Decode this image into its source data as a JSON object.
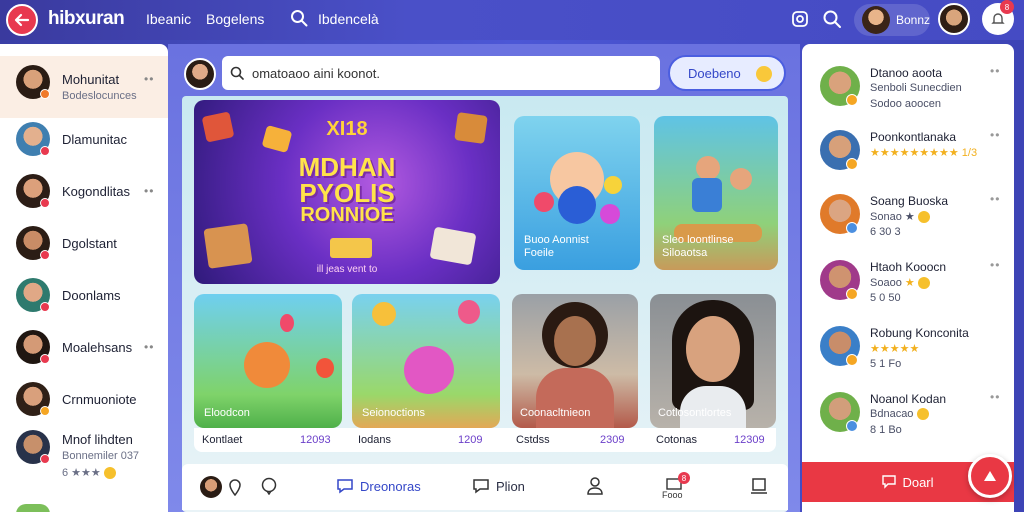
{
  "colors": {
    "accent": "#4b5ee0",
    "danger": "#e93844",
    "topbar": "#3a3a9e"
  },
  "topbar": {
    "brand": "hibxuran",
    "nav": [
      "Ibeanic",
      "Bogelens"
    ],
    "search_text": "Ibdencelà",
    "user_chip_name": "Bonnz",
    "notification_count": "8",
    "icons": [
      "back-arrow-icon",
      "search-icon",
      "settings-icon",
      "bell-icon"
    ]
  },
  "sidebar_left": {
    "items": [
      {
        "name": "Mohunitat",
        "sub": "Bodeslocunces",
        "badge_color": "#f07a2a",
        "active": true,
        "more": "••"
      },
      {
        "name": "Dlamunitac",
        "sub": "",
        "badge_color": "#e8394f",
        "active": false,
        "more": ""
      },
      {
        "name": "Kogondlitas",
        "sub": "",
        "badge_color": "#e8394f",
        "active": false,
        "more": "••"
      },
      {
        "name": "Dgolstant",
        "sub": "",
        "badge_color": "#e8394f",
        "active": false,
        "more": ""
      },
      {
        "name": "Doonlams",
        "sub": "",
        "badge_color": "#e8394f",
        "active": false,
        "more": ""
      },
      {
        "name": "Moalehsans",
        "sub": "",
        "badge_color": "#e8394f",
        "active": false,
        "more": "••"
      },
      {
        "name": "Crnmuoniote",
        "sub": "",
        "badge_color": "#f5a623",
        "active": false,
        "more": ""
      },
      {
        "name": "Mnof lihdten",
        "sub": "Bonnemiler 037",
        "sub2": "6 ★★★",
        "badge_color": "#e8394f",
        "active": false,
        "more": ""
      }
    ]
  },
  "center": {
    "search_placeholder": "omatoaoo aini koonot.",
    "top_button": "Doebeno",
    "hero": {
      "line1": "XI18",
      "line2": "MDHAN",
      "line3": "PYOLIS",
      "line4": "RONNIOE",
      "caption": "ill jeas vent to"
    },
    "cards_top": [
      {
        "caption1": "Buoo Aonnist",
        "caption2": "Foeile"
      },
      {
        "caption1": "Sleo loontlinse",
        "caption2": "Siloaotsa"
      }
    ],
    "cards_bottom": [
      {
        "caption": "Eloodcon",
        "stat_left": "Kontlaet",
        "stat_right": "12093"
      },
      {
        "caption": "Seionoctions",
        "stat_left": "Iodans",
        "stat_right": "1209"
      },
      {
        "caption": "Coonacltnieon",
        "stat_left": "Cstdss",
        "stat_right": "2309"
      },
      {
        "caption": "Cotlosontlortes",
        "stat_left": "Cotonas",
        "stat_right": "12309"
      }
    ],
    "bottom_bar": {
      "item_chat": "Dreonoras",
      "item_pin": "Plion",
      "item_badge_label": "Fooo",
      "item_badge_count": "8"
    }
  },
  "sidebar_right": {
    "items": [
      {
        "name": "Dtanoo aoota",
        "sub": "Senboli Sunecdien",
        "sub2": "Sodoo aoocen",
        "more": "••",
        "badge_color": "#f5a623"
      },
      {
        "name": "Poonkontlanaka",
        "sub": "★★★★★★★★★ 1/3",
        "sub2": "",
        "more": "••",
        "badge_color": "#f5a623"
      },
      {
        "name": "Soang Buoska",
        "sub": "Sonao ★",
        "sub2": "6 30 3",
        "more": "••",
        "badge_color": "#4b8fe0"
      },
      {
        "name": "Htaoh Kooocn",
        "sub": "Soaoo",
        "sub2": "5 0 50",
        "more": "••",
        "badge_color": "#f5a623"
      },
      {
        "name": "Robung Konconita",
        "sub": "★★★★★",
        "sub2": "5 1 Fo",
        "more": "",
        "badge_color": "#f5a623"
      },
      {
        "name": "Noanol Kodan",
        "sub": "Bdnacao",
        "sub2": "8 1 Bo",
        "more": "••",
        "badge_color": "#4b8fe0"
      }
    ],
    "cta": "Doarl"
  }
}
